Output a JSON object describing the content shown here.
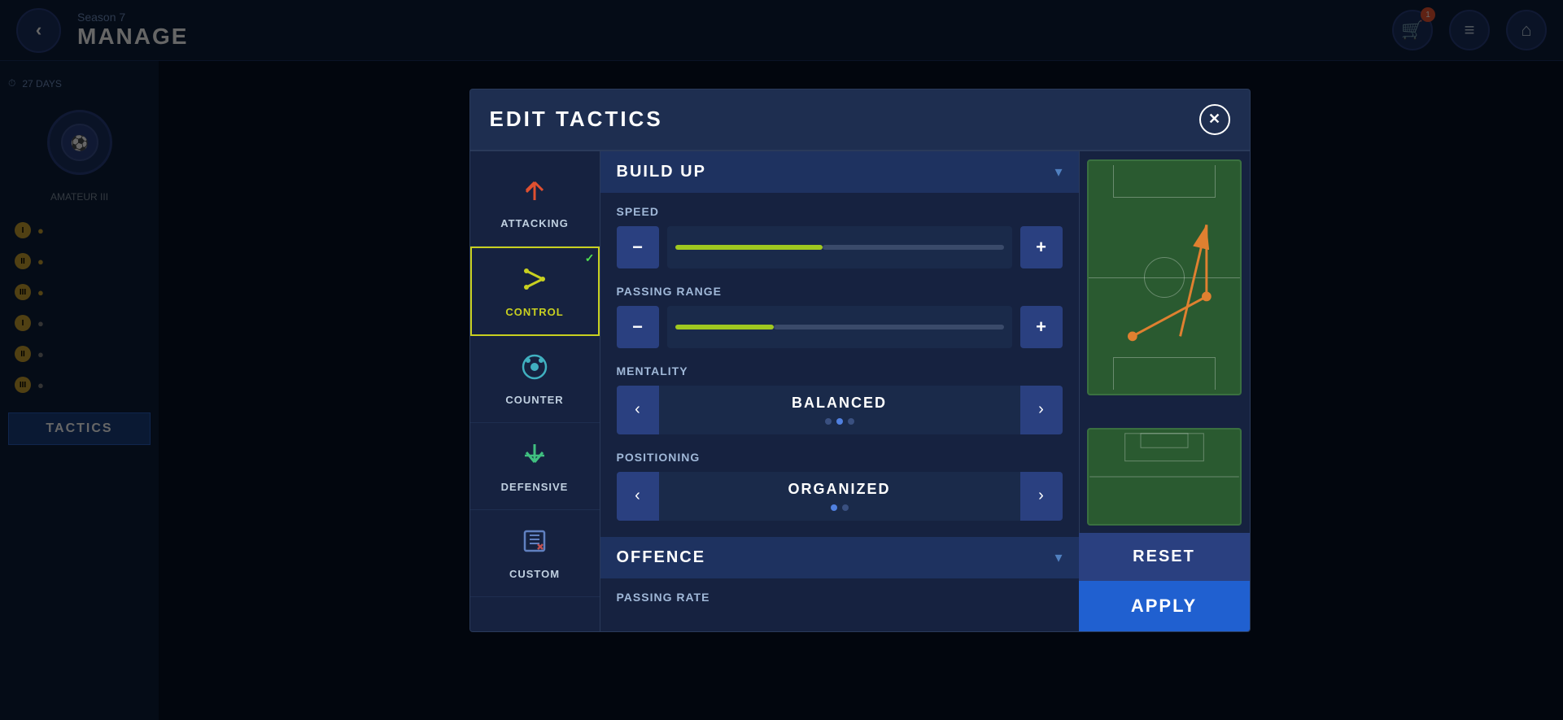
{
  "app": {
    "season": "Season 7",
    "title": "MANAGE",
    "days_left": "27 DAYS",
    "back_label": "‹",
    "close_label": "✕"
  },
  "top_icons": {
    "cart_label": "🛒",
    "menu_label": "≡",
    "home_label": "⌂"
  },
  "sidebar": {
    "level": "AMATEUR III",
    "tactics_label": "TACTICS"
  },
  "dialog": {
    "title": "EDIT TACTICS",
    "close_label": "✕"
  },
  "tactic_items": [
    {
      "id": "attacking",
      "label": "ATTACKING",
      "icon": "⬆",
      "active": false
    },
    {
      "id": "control",
      "label": "CONTROL",
      "icon": "⤢",
      "active": true
    },
    {
      "id": "counter",
      "label": "COUNTER",
      "icon": "↺",
      "active": false
    },
    {
      "id": "defensive",
      "label": "DEFENSIVE",
      "icon": "⬇",
      "active": false
    },
    {
      "id": "custom",
      "label": "CUSTOM",
      "icon": "📋",
      "active": false
    }
  ],
  "sections": {
    "build_up": {
      "title": "BUILD UP",
      "expanded": true,
      "settings": {
        "speed": {
          "label": "SPEED",
          "value": 45,
          "minus": "−",
          "plus": "+"
        },
        "passing_range": {
          "label": "PASSING RANGE",
          "value": 30,
          "minus": "−",
          "plus": "+"
        },
        "mentality": {
          "label": "MENTALITY",
          "value": "BALANCED",
          "prev": "‹",
          "next": "›",
          "dots": [
            false,
            true,
            false
          ]
        },
        "positioning": {
          "label": "POSITIONING",
          "value": "ORGANIZED",
          "prev": "‹",
          "next": "›",
          "dots": [
            true,
            false
          ]
        }
      }
    },
    "offence": {
      "title": "OFFENCE",
      "expanded": false,
      "settings": {
        "passing_rate": {
          "label": "PASSING RATE"
        }
      }
    }
  },
  "actions": {
    "reset_label": "RESET",
    "apply_label": "APPLY"
  },
  "field": {
    "tactic_arrows": true
  }
}
